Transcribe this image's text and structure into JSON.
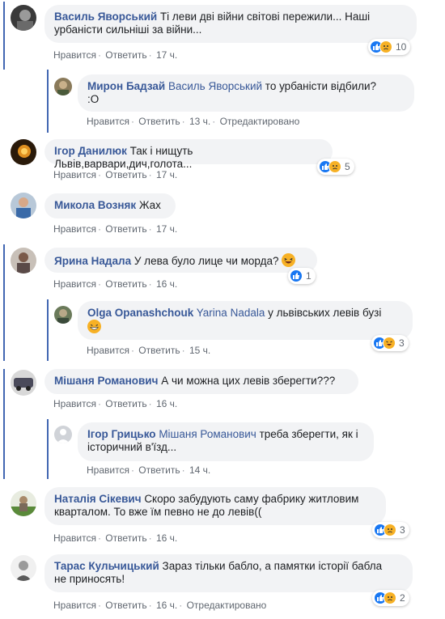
{
  "comments": [
    {
      "author": "Василь Яворський",
      "text": "Ті леви дві війни світові пережили... Наші урбаністи сильніші за війни...",
      "line1": "Ті леви дві війни світові пережили... Наші",
      "line2": "урбаністи сильніші за війни...",
      "like": "Нравится",
      "reply": "Ответить",
      "time": "17 ч.",
      "reactions": "10"
    },
    {
      "author": "Мирон Бадзай",
      "mention": "Василь Яворський",
      "text": "то урбаністи відбили?",
      "line2": ":О",
      "like": "Нравится",
      "reply": "Ответить",
      "time": "13 ч.",
      "edited": "Отредактировано"
    },
    {
      "author": "Ігор Данилюк",
      "text": "Так і нищуть Львів,варвари,дич,голота...",
      "like": "Нравится",
      "reply": "Ответить",
      "time": "17 ч.",
      "reactions": "5"
    },
    {
      "author": "Микола Возняк",
      "text": "Жах",
      "like": "Нравится",
      "reply": "Ответить",
      "time": "17 ч."
    },
    {
      "author": "Ярина Надала",
      "text": "У лева було лице чи морда?",
      "like": "Нравится",
      "reply": "Ответить",
      "time": "16 ч.",
      "reactions": "1"
    },
    {
      "author": "Olga Opanashchouk",
      "mention": "Yarina Nadala",
      "text": "у львівських левів бузі",
      "like": "Нравится",
      "reply": "Ответить",
      "time": "15 ч.",
      "reactions": "3"
    },
    {
      "author": "Мішаня Романович",
      "text": "А чи можна цих левів зберегти???",
      "like": "Нравится",
      "reply": "Ответить",
      "time": "16 ч."
    },
    {
      "author": "Ігор Грицько",
      "mention": "Мішаня Романович",
      "text": "треба зберегти, як і",
      "line2": "історичний в'їзд...",
      "like": "Нравится",
      "reply": "Ответить",
      "time": "14 ч."
    },
    {
      "author": "Наталія Сікевич",
      "text": "Скоро забудують саму фабрику житловим",
      "line2": "кварталом. То вже їм певно не до левів((",
      "like": "Нравится",
      "reply": "Ответить",
      "time": "16 ч.",
      "reactions": "3"
    },
    {
      "author": "Тарас Кульчицький",
      "text": "Зараз тільки бабло, а памятки історії бабла",
      "line2": "не приносять!",
      "like": "Нравится",
      "reply": "Ответить",
      "time": "16 ч.",
      "edited": "Отредактировано",
      "reactions": "2"
    }
  ],
  "colors": {
    "link": "#385898",
    "bubble": "#f2f3f5",
    "reply_bar": "#4267b2",
    "like": "#1877f2",
    "emoji": "#f7b125"
  },
  "icons": {
    "like": "like-icon",
    "sad": "sad-icon",
    "haha": "haha-icon",
    "laugh_emoji": "laughing-emoji",
    "grin_emoji": "grinning-emoji"
  }
}
